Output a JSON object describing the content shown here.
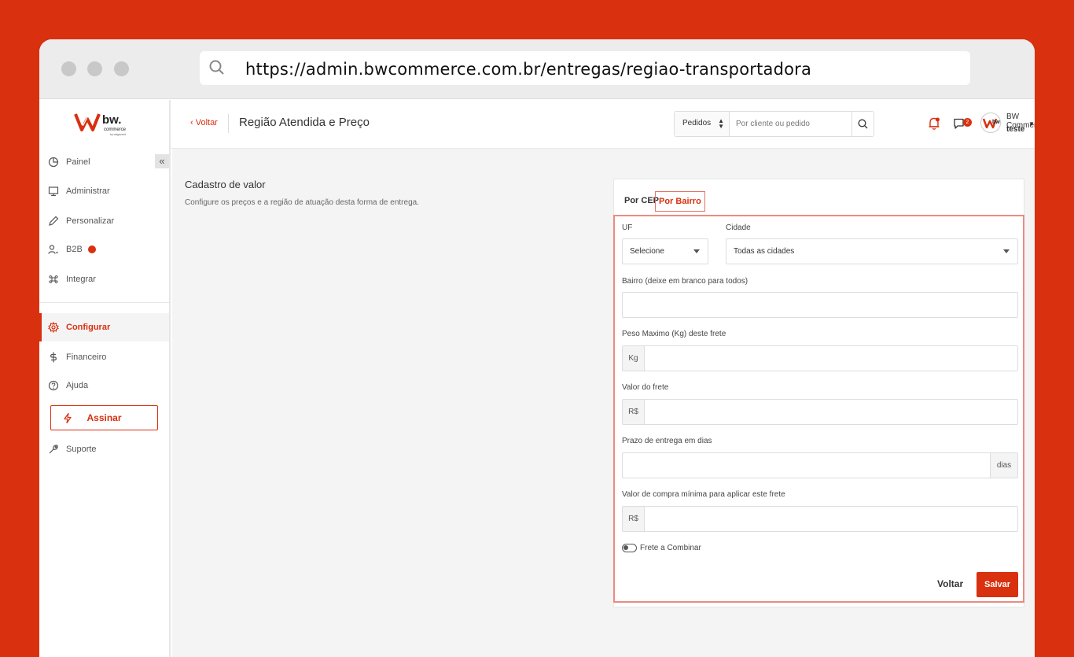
{
  "browser": {
    "url": "https://admin.bwcommerce.com.br/entregas/regiao-transportadora"
  },
  "sidebar": {
    "collapse_label": "«",
    "items": [
      {
        "label": "Painel",
        "icon": "dashboard-icon"
      },
      {
        "label": "Administrar",
        "icon": "monitor-icon"
      },
      {
        "label": "Personalizar",
        "icon": "pencil-icon"
      },
      {
        "label": "B2B",
        "icon": "users-icon"
      },
      {
        "label": "Integrar",
        "icon": "command-icon"
      },
      {
        "label": "Configurar",
        "icon": "gear-icon",
        "active": true
      },
      {
        "label": "Financeiro",
        "icon": "dollar-icon"
      },
      {
        "label": "Ajuda",
        "icon": "help-icon"
      },
      {
        "label": "Suporte",
        "icon": "wrench-icon"
      }
    ],
    "assinar_label": "Assinar"
  },
  "header": {
    "back_label": "‹ Voltar",
    "title": "Região Atendida e Preço",
    "search_select": "Pedidos",
    "search_placeholder": "Por cliente ou pedido",
    "chat_count": "2",
    "user_name": "BW Commerce",
    "user_sub": "teste"
  },
  "section": {
    "title": "Cadastro de valor",
    "description": "Configure os preços e a região de atuação desta forma de entrega."
  },
  "form": {
    "tabs": [
      "Por CEP",
      "Por Bairro"
    ],
    "uf_label": "UF",
    "uf_value": "Selecione",
    "cidade_label": "Cidade",
    "cidade_value": "Todas as cidades",
    "bairro_label": "Bairro (deixe em branco para todos)",
    "peso_label": "Peso Maximo (Kg) deste frete",
    "peso_addon": "Kg",
    "valor_label": "Valor do frete",
    "valor_addon": "R$",
    "prazo_label": "Prazo de entrega em dias",
    "prazo_addon": "dias",
    "minimo_label": "Valor de compra mínima para aplicar este frete",
    "minimo_addon": "R$",
    "toggle_label": "Frete a Combinar",
    "toggle_on": false,
    "btn_voltar": "Voltar",
    "btn_salvar": "Salvar"
  },
  "colors": {
    "brand": "#d9300f",
    "highlight_border": "#ec8a80"
  }
}
